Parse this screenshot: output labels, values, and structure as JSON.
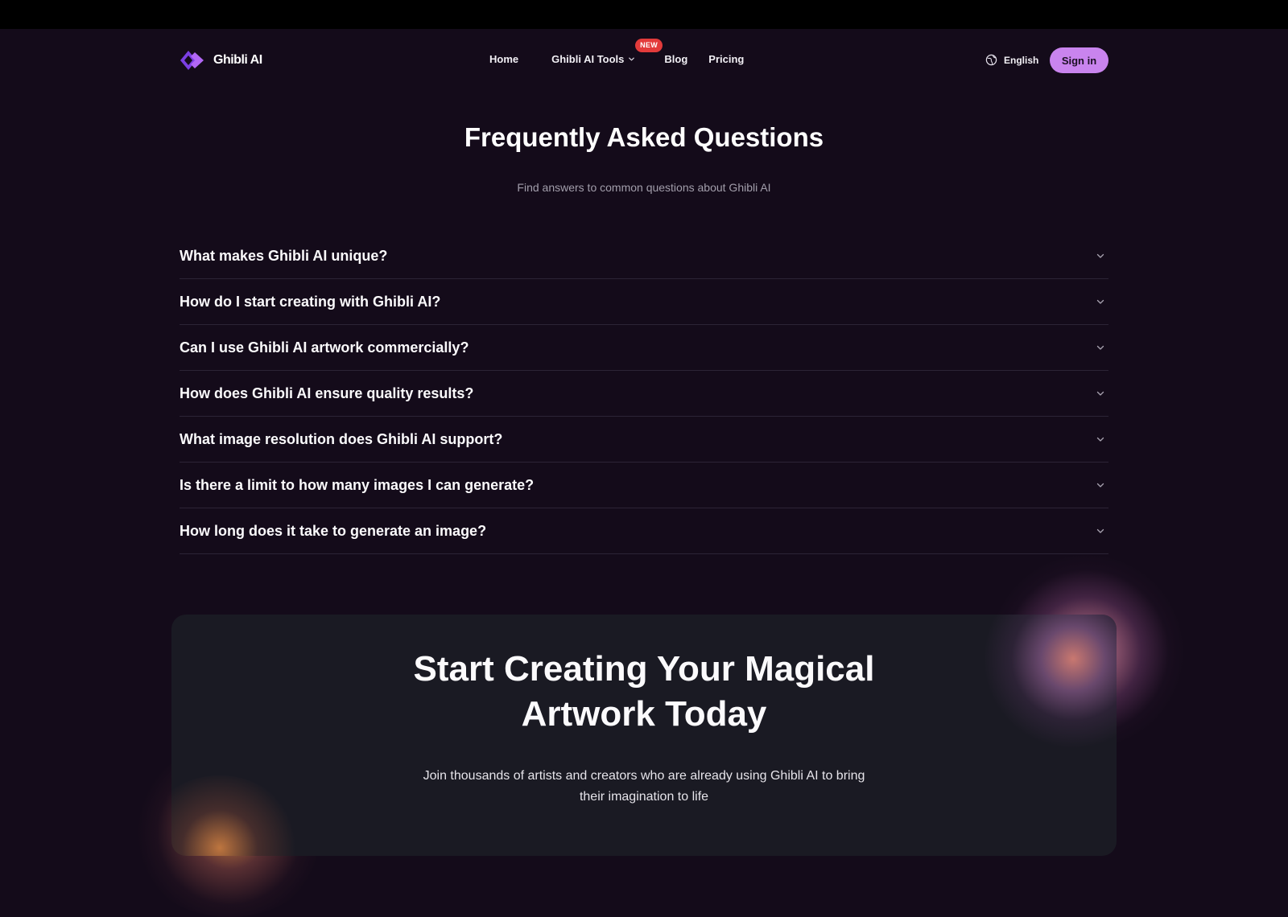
{
  "nav": {
    "logo_text": "Ghibli AI",
    "links": {
      "home": "Home",
      "tools": "Ghibli AI Tools",
      "tools_badge": "NEW",
      "blog": "Blog",
      "pricing": "Pricing"
    },
    "language": "English",
    "signin": "Sign in"
  },
  "faq": {
    "title": "Frequently Asked Questions",
    "subtitle": "Find answers to common questions about Ghibli AI",
    "items": [
      "What makes Ghibli AI unique?",
      "How do I start creating with Ghibli AI?",
      "Can I use Ghibli AI artwork commercially?",
      "How does Ghibli AI ensure quality results?",
      "What image resolution does Ghibli AI support?",
      "Is there a limit to how many images I can generate?",
      "How long does it take to generate an image?"
    ]
  },
  "cta": {
    "title_line1": "Start Creating Your Magical",
    "title_line2": "Artwork Today",
    "subtitle_line1": "Join thousands of artists and creators who are already using Ghibli AI to bring",
    "subtitle_line2": "their imagination to life"
  },
  "colors": {
    "background": "#140b1a",
    "accent": "#c984ee",
    "badge": "#e33b3b",
    "cta_card": "#1a1a23"
  },
  "icons": {
    "logo": "diamond-logo-icon",
    "dropdown": "chevron-down-icon",
    "language": "globe-icon",
    "faq_toggle": "chevron-down-icon"
  }
}
